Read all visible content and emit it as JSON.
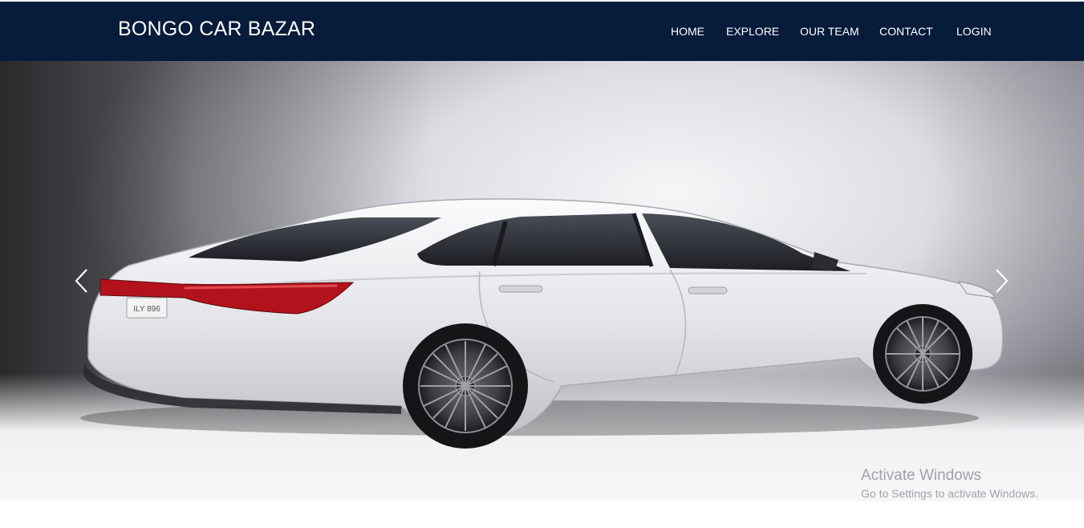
{
  "brand": {
    "name": "BONGO CAR BAZAR"
  },
  "nav": {
    "items": [
      {
        "label": "HOME"
      },
      {
        "label": "EXPLORE"
      },
      {
        "label": "OUR TEAM"
      },
      {
        "label": "CONTACT"
      },
      {
        "label": "LOGIN"
      }
    ]
  },
  "hero": {
    "image_alt": "white sedan",
    "prev_icon": "chevron-left-icon",
    "next_icon": "chevron-right-icon",
    "plate_text": "ILY 896"
  },
  "watermark": {
    "title": "Activate Windows",
    "subtitle": "Go to Settings to activate Windows."
  },
  "colors": {
    "navbar": "#071b3b",
    "nav_text": "#ffffff",
    "car_body": "#e8e9ec",
    "tail_light": "#b3121c"
  }
}
